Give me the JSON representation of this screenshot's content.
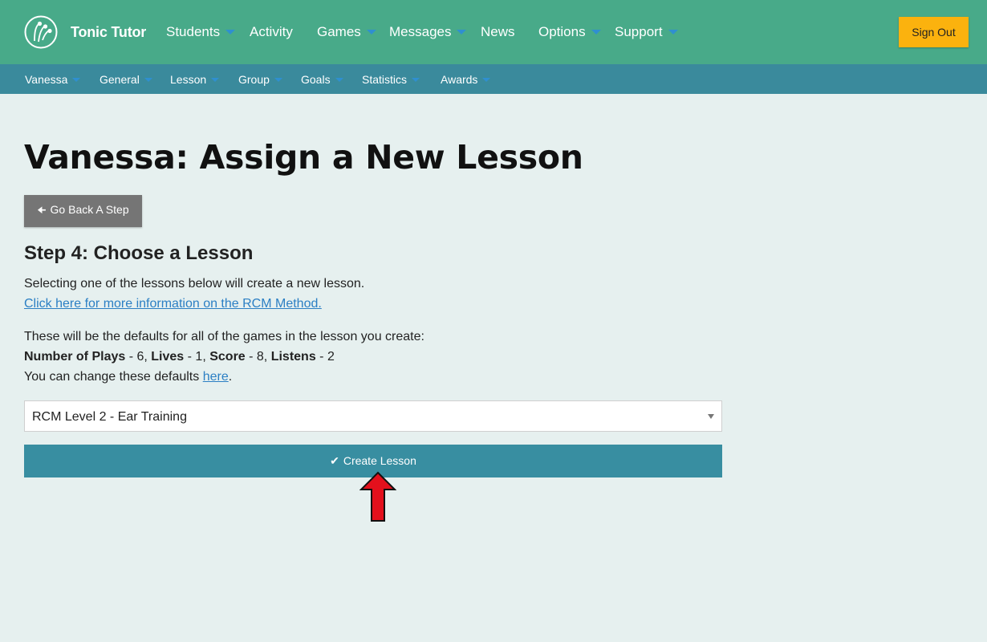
{
  "header": {
    "brand": "Tonic Tutor",
    "nav": [
      {
        "label": "Students",
        "dropdown": true
      },
      {
        "label": "Activity",
        "dropdown": false
      },
      {
        "label": "Games",
        "dropdown": true
      },
      {
        "label": "Messages",
        "dropdown": true
      },
      {
        "label": "News",
        "dropdown": false
      },
      {
        "label": "Options",
        "dropdown": true
      },
      {
        "label": "Support",
        "dropdown": true
      }
    ],
    "sign_out": "Sign Out"
  },
  "subnav": {
    "items": [
      "Vanessa",
      "General",
      "Lesson",
      "Group",
      "Goals",
      "Statistics",
      "Awards"
    ]
  },
  "main": {
    "title": "Vanessa: Assign a New Lesson",
    "back_button": "Go Back A Step",
    "step_heading": "Step 4: Choose a Lesson",
    "intro": "Selecting one of the lessons below will create a new lesson.",
    "rcm_link": "Click here for more information on the RCM Method.",
    "defaults_intro": "These will be the defaults for all of the games in the lesson you create:",
    "defaults": {
      "plays_label": "Number of Plays",
      "plays_value": " - 6, ",
      "lives_label": "Lives",
      "lives_value": " - 1, ",
      "score_label": "Score",
      "score_value": " - 8, ",
      "listens_label": "Listens",
      "listens_value": " - 2"
    },
    "change_text": "You can change these defaults ",
    "change_link": "here",
    "change_end": ".",
    "lesson_select": "RCM Level 2 - Ear Training",
    "create_button": "Create Lesson"
  },
  "colors": {
    "header": "#48aa89",
    "subnav": "#3a8a9c",
    "sign_out": "#fbb20e",
    "primary_button": "#388ea1",
    "back_button": "#757575",
    "link": "#2b7fc4",
    "annotation_arrow": "#e3101c"
  },
  "icons": {
    "logo": "music-notes-logo-icon",
    "back": "arrow-left-icon",
    "create": "checkmark-icon",
    "select": "caret-down-icon",
    "annotation": "red-arrow-up-icon"
  }
}
